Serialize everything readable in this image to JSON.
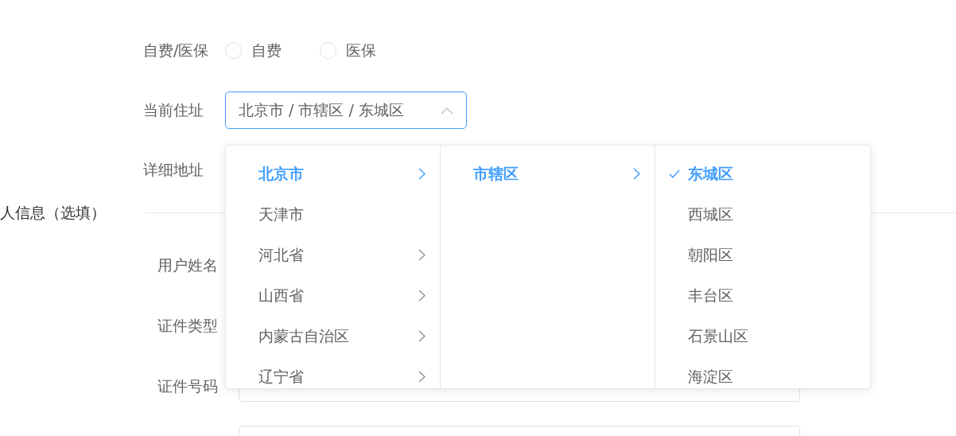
{
  "payment": {
    "label": "自费/医保",
    "options": [
      {
        "label": "自费",
        "selected": false
      },
      {
        "label": "医保",
        "selected": false
      }
    ]
  },
  "address": {
    "label": "当前住址",
    "value": "北京市 / 市辖区 / 东城区",
    "expanded": true
  },
  "cascader": {
    "columns": [
      {
        "items": [
          {
            "label": "北京市",
            "selected": true,
            "has_children": true
          },
          {
            "label": "天津市",
            "selected": false,
            "has_children": false
          },
          {
            "label": "河北省",
            "selected": false,
            "has_children": true
          },
          {
            "label": "山西省",
            "selected": false,
            "has_children": true
          },
          {
            "label": "内蒙古自治区",
            "selected": false,
            "has_children": true
          },
          {
            "label": "辽宁省",
            "selected": false,
            "has_children": true
          }
        ]
      },
      {
        "items": [
          {
            "label": "市辖区",
            "selected": true,
            "has_children": true
          }
        ]
      },
      {
        "items": [
          {
            "label": "东城区",
            "selected": true,
            "has_children": false
          },
          {
            "label": "西城区",
            "selected": false,
            "has_children": false
          },
          {
            "label": "朝阳区",
            "selected": false,
            "has_children": false
          },
          {
            "label": "丰台区",
            "selected": false,
            "has_children": false
          },
          {
            "label": "石景山区",
            "selected": false,
            "has_children": false
          },
          {
            "label": "海淀区",
            "selected": false,
            "has_children": false
          }
        ]
      }
    ]
  },
  "detail": {
    "label": "详细地址"
  },
  "section": {
    "title": "人信息（选填）"
  },
  "contact_fields": [
    {
      "label": "用户姓名"
    },
    {
      "label": "证件类型"
    },
    {
      "label": "证件号码"
    }
  ]
}
